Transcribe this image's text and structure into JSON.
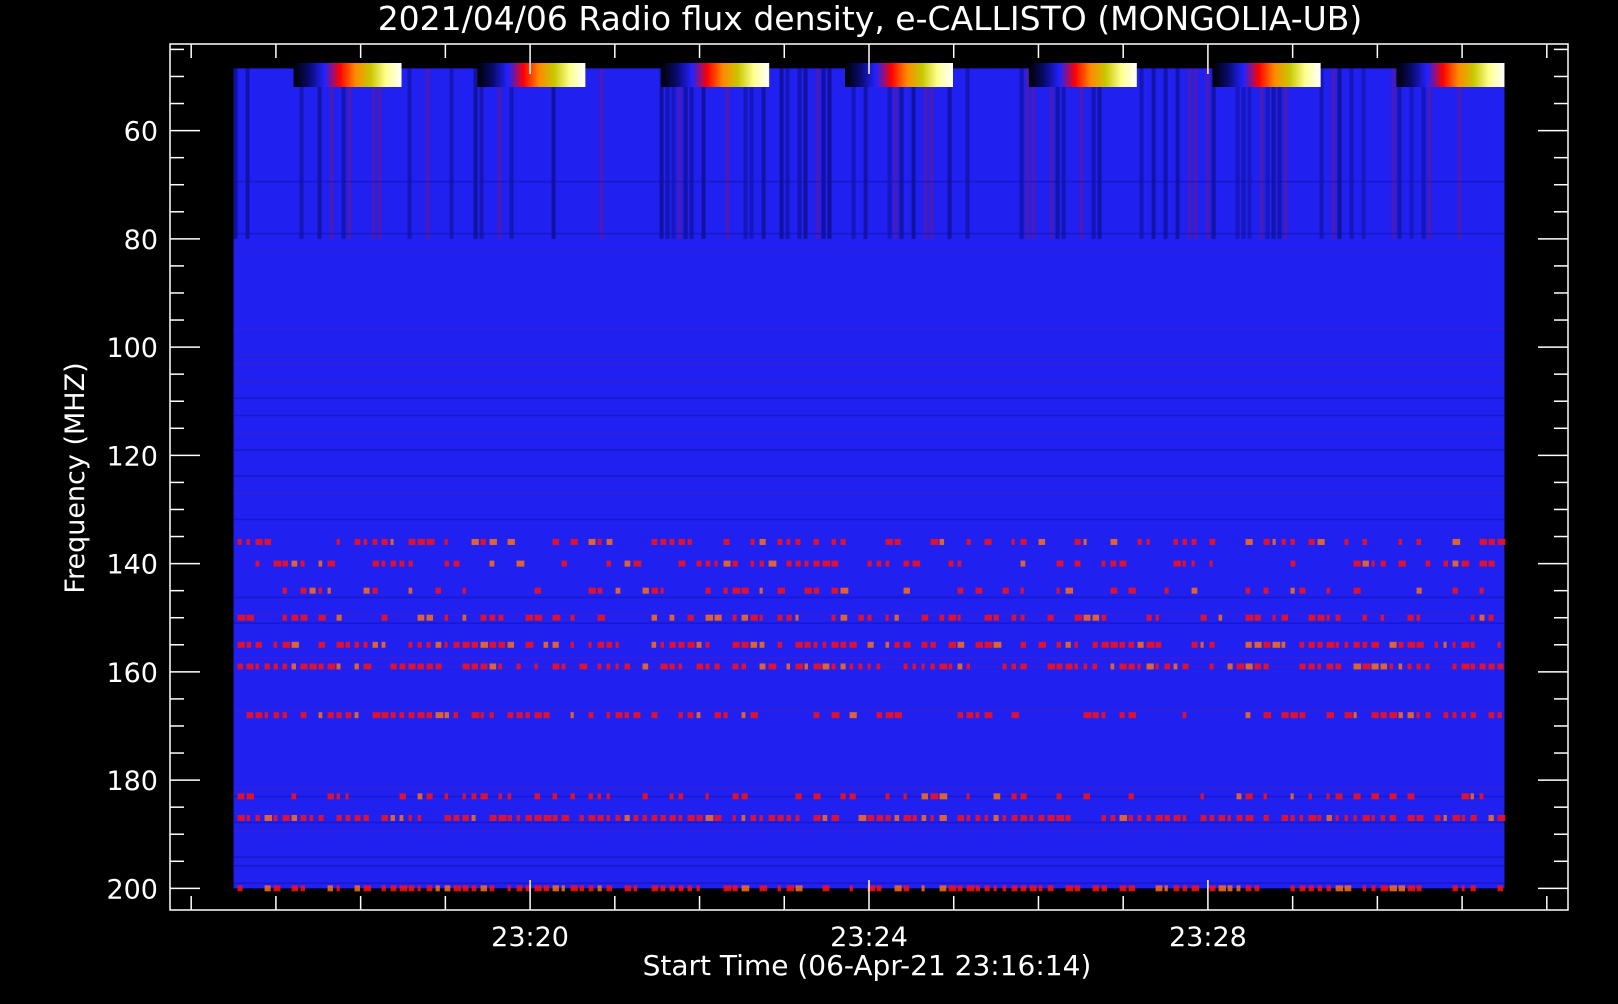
{
  "chart_data": {
    "type": "heatmap",
    "title": "2021/04/06  Radio flux density, e-CALLISTO (MONGOLIA-UB)",
    "xlabel": "Start Time (06-Apr-21 23:16:14)",
    "ylabel": "Frequency (MHZ)",
    "x_ticks": [
      "23:20",
      "23:24",
      "23:28"
    ],
    "y_ticks": [
      60,
      80,
      100,
      120,
      140,
      160,
      180,
      200
    ],
    "x_start_time": "23:16:14",
    "x_range_minutes": [
      -0.25,
      16.25
    ],
    "y_range": [
      44,
      204
    ],
    "data_x_range_minutes": [
      0.5,
      15.5
    ],
    "data_y_range": [
      48.5,
      200
    ],
    "y_axis_direction": "inverted",
    "colormap": [
      "#000000",
      "#0a0a6e",
      "#2222ff",
      "#ff0000",
      "#ff8800",
      "#c8c800",
      "#ffff90",
      "#ffffff"
    ],
    "background_color": "#2020f0",
    "strong_bands_mhz": [
      {
        "freq": 136,
        "intensity": 0.55
      },
      {
        "freq": 140,
        "intensity": 0.45
      },
      {
        "freq": 145,
        "intensity": 0.4
      },
      {
        "freq": 150,
        "intensity": 0.5
      },
      {
        "freq": 155,
        "intensity": 0.7
      },
      {
        "freq": 159,
        "intensity": 0.8
      },
      {
        "freq": 168,
        "intensity": 0.6
      },
      {
        "freq": 183,
        "intensity": 0.45
      },
      {
        "freq": 187,
        "intensity": 0.85
      },
      {
        "freq": 200,
        "intensity": 0.75
      }
    ],
    "colorbar_count": 7
  }
}
